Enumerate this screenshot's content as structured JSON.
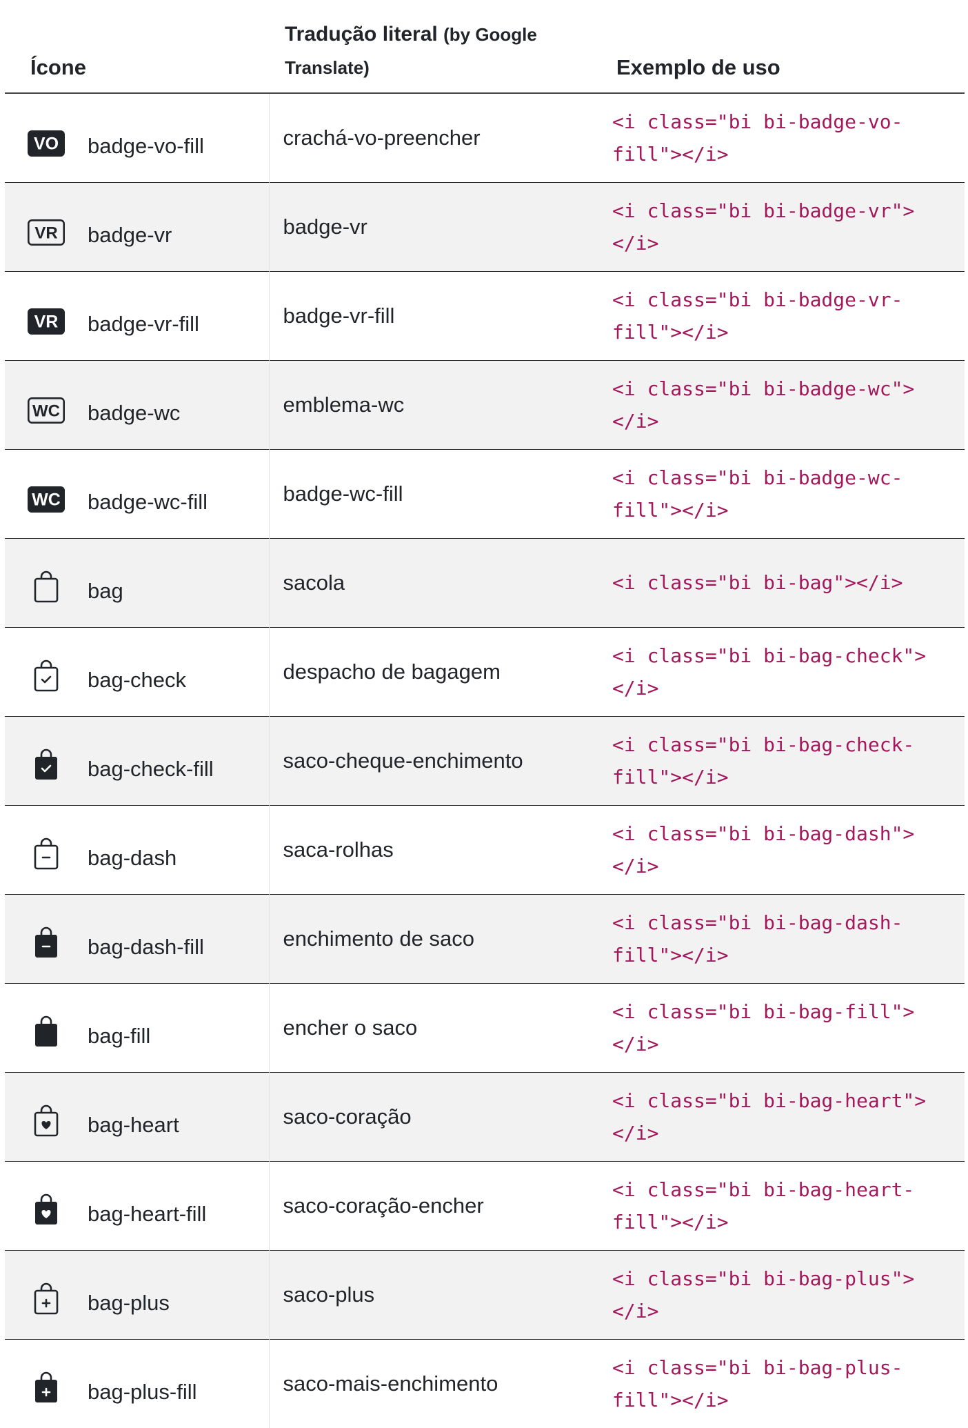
{
  "header": {
    "col_icon": "Ícone",
    "col_translation": "Tradução literal",
    "col_translation_note": "(by Google Translate)",
    "col_example": "Exemplo de uso"
  },
  "colors": {
    "code": "#a3195b",
    "text": "#212529",
    "stripe": "#f2f2f2"
  },
  "rows": [
    {
      "icon": "badge-vo-fill-icon",
      "name": "badge-vo-fill",
      "translation": "crachá-vo-preencher",
      "code1": "<i class=\"bi bi-badge-vo-",
      "code2": "fill\"></i>"
    },
    {
      "icon": "badge-vr-icon",
      "name": "badge-vr",
      "translation": "badge-vr",
      "code1": "<i class=\"bi bi-badge-vr\">",
      "code2": "</i>"
    },
    {
      "icon": "badge-vr-fill-icon",
      "name": "badge-vr-fill",
      "translation": "badge-vr-fill",
      "code1": "<i class=\"bi bi-badge-vr-",
      "code2": "fill\"></i>"
    },
    {
      "icon": "badge-wc-icon",
      "name": "badge-wc",
      "translation": "emblema-wc",
      "code1": "<i class=\"bi bi-badge-wc\">",
      "code2": "</i>"
    },
    {
      "icon": "badge-wc-fill-icon",
      "name": "badge-wc-fill",
      "translation": "badge-wc-fill",
      "code1": "<i class=\"bi bi-badge-wc-",
      "code2": "fill\"></i>"
    },
    {
      "icon": "bag-icon",
      "name": "bag",
      "translation": "sacola",
      "code1": "<i class=\"bi bi-bag\"></i>",
      "code2": ""
    },
    {
      "icon": "bag-check-icon",
      "name": "bag-check",
      "translation": "despacho de bagagem",
      "code1": "<i class=\"bi bi-bag-check\">",
      "code2": "</i>"
    },
    {
      "icon": "bag-check-fill-icon",
      "name": "bag-check-fill",
      "translation": "saco-cheque-enchimento",
      "code1": "<i class=\"bi bi-bag-check-",
      "code2": "fill\"></i>"
    },
    {
      "icon": "bag-dash-icon",
      "name": "bag-dash",
      "translation": "saca-rolhas",
      "code1": "<i class=\"bi bi-bag-dash\">",
      "code2": "</i>"
    },
    {
      "icon": "bag-dash-fill-icon",
      "name": "bag-dash-fill",
      "translation": "enchimento de saco",
      "code1": "<i class=\"bi bi-bag-dash-",
      "code2": "fill\"></i>"
    },
    {
      "icon": "bag-fill-icon",
      "name": "bag-fill",
      "translation": "encher o saco",
      "code1": "<i class=\"bi bi-bag-fill\">",
      "code2": "</i>"
    },
    {
      "icon": "bag-heart-icon",
      "name": "bag-heart",
      "translation": "saco-coração",
      "code1": "<i class=\"bi bi-bag-heart\">",
      "code2": "</i>"
    },
    {
      "icon": "bag-heart-fill-icon",
      "name": "bag-heart-fill",
      "translation": "saco-coração-encher",
      "code1": "<i class=\"bi bi-bag-heart-",
      "code2": "fill\"></i>"
    },
    {
      "icon": "bag-plus-icon",
      "name": "bag-plus",
      "translation": "saco-plus",
      "code1": "<i class=\"bi bi-bag-plus\">",
      "code2": "</i>"
    },
    {
      "icon": "bag-plus-fill-icon",
      "name": "bag-plus-fill",
      "translation": "saco-mais-enchimento",
      "code1": "<i class=\"bi bi-bag-plus-",
      "code2": "fill\"></i>"
    }
  ]
}
